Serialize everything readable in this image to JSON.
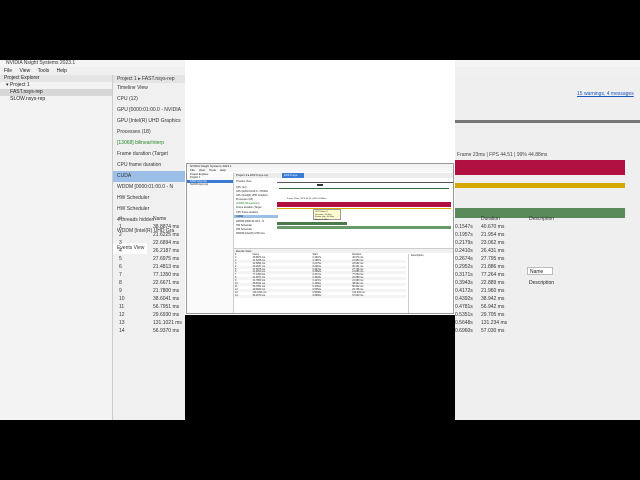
{
  "app": {
    "window_title": "NVIDIA Nsight Systems 2023.1",
    "menu": [
      "File",
      "View",
      "Tools",
      "Help"
    ],
    "tab_title": "Project 1 ▸ FAST.nsys-rep",
    "timeline_view": "Timeline View",
    "events_view": "Events View",
    "warnings": "15 warnings, 4 messages",
    "project_explorer": "Project Explorer",
    "project_name": "Project 1",
    "files": [
      "FAST.nsys-rep",
      "SLOW.nsys-rep"
    ]
  },
  "timeline": {
    "rows": [
      "CPU (12)",
      "GPU [0000:01:00.0 - NVIDIA",
      "GPU [Intel(R) UHD Graphics",
      "Processes (18)",
      "[13068] bilinearInterp",
      "Frame duration (Target",
      "CPU frame duration",
      "CUDA",
      "WDDM [0000:01:00.0 - N",
      "HW Scheduler",
      "HW Scheduler",
      "4 threads hidden",
      "WDDM [Intel(R) UHD Gra"
    ],
    "frame_summary": "Frame 23ms | FPS 44.51 | 99% 44.88ms",
    "tooltip_lines": [
      "CPU frame 4",
      "Duration: 22.4ms",
      "Frame rate: 44.5fps",
      "Begin: 0.431s"
    ]
  },
  "events": {
    "columns": [
      "#",
      "Name",
      "Start",
      "Duration"
    ],
    "right_column": "Description",
    "filter_label": "Name",
    "rows": [
      [
        "1",
        "38.8874 ms",
        "0.1547s",
        "40.670 ms"
      ],
      [
        "2",
        "21.6225 ms",
        "0.1957s",
        "21.954 ms"
      ],
      [
        "3",
        "22.6894 ms",
        "0.2179s",
        "23.062 ms"
      ],
      [
        "4",
        "26.2187 ms",
        "0.2410s",
        "26.431 ms"
      ],
      [
        "5",
        "27.6975 ms",
        "0.2674s",
        "27.795 ms"
      ],
      [
        "6",
        "21.4813 ms",
        "0.2952s",
        "21.886 ms"
      ],
      [
        "7",
        "77.1350 ms",
        "0.3171s",
        "77.264 ms"
      ],
      [
        "8",
        "22.6671 ms",
        "0.3943s",
        "22.889 ms"
      ],
      [
        "9",
        "21.7800 ms",
        "0.4172s",
        "21.960 ms"
      ],
      [
        "10",
        "38.6041 ms",
        "0.4392s",
        "38.942 ms"
      ],
      [
        "11",
        "56.7951 ms",
        "0.4781s",
        "56.942 ms"
      ],
      [
        "12",
        "29.6930 ms",
        "0.5351s",
        "29.705 ms"
      ],
      [
        "13",
        "131.1021 ms",
        "0.5648s",
        "131.234 ms"
      ],
      [
        "14",
        "56.9370 ms",
        "0.6960s",
        "57.030 ms"
      ]
    ]
  },
  "colors": {
    "frame_bar": "#b01040",
    "gpu_bar": "#4b7a4b",
    "selection": "#3b7bd4"
  }
}
